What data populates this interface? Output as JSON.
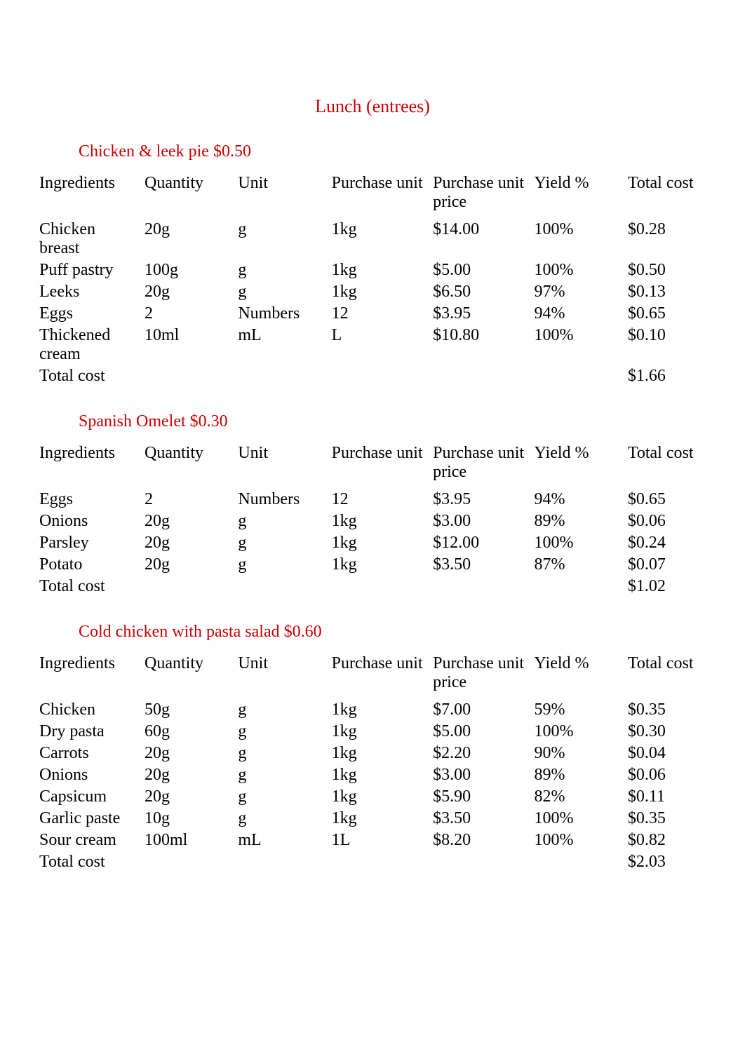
{
  "page_title": "Lunch (entrees)",
  "columns": {
    "ingredients": "Ingredients",
    "quantity": "Quantity",
    "unit": "Unit",
    "purchase_unit": "Purchase unit",
    "purchase_unit_price": "Purchase unit price",
    "yield": "Yield %",
    "total_cost": "Total cost"
  },
  "total_cost_label": "Total cost",
  "recipes": [
    {
      "title": "Chicken & leek pie $0.50",
      "total": "$1.66",
      "rows": [
        {
          "ingredient": "Chicken breast",
          "quantity": "20g",
          "unit": "g",
          "purchase_unit": "1kg",
          "purchase_unit_price": "$14.00",
          "yield": "100%",
          "total_cost": "$0.28"
        },
        {
          "ingredient": "Puff pastry",
          "quantity": "100g",
          "unit": "g",
          "purchase_unit": "1kg",
          "purchase_unit_price": "$5.00",
          "yield": "100%",
          "total_cost": "$0.50"
        },
        {
          "ingredient": "Leeks",
          "quantity": "20g",
          "unit": "g",
          "purchase_unit": "1kg",
          "purchase_unit_price": "$6.50",
          "yield": "97%",
          "total_cost": "$0.13"
        },
        {
          "ingredient": "Eggs",
          "quantity": "2",
          "unit": "Numbers",
          "purchase_unit": "12",
          "purchase_unit_price": "$3.95",
          "yield": "94%",
          "total_cost": "$0.65"
        },
        {
          "ingredient": "Thickened cream",
          "quantity": "10ml",
          "unit": "mL",
          "purchase_unit": "L",
          "purchase_unit_price": "$10.80",
          "yield": "100%",
          "total_cost": "$0.10"
        }
      ]
    },
    {
      "title": "Spanish Omelet $0.30",
      "total": "$1.02",
      "rows": [
        {
          "ingredient": "Eggs",
          "quantity": "2",
          "unit": "Numbers",
          "purchase_unit": "12",
          "purchase_unit_price": "$3.95",
          "yield": "94%",
          "total_cost": "$0.65"
        },
        {
          "ingredient": "Onions",
          "quantity": "20g",
          "unit": "g",
          "purchase_unit": "1kg",
          "purchase_unit_price": "$3.00",
          "yield": "89%",
          "total_cost": "$0.06"
        },
        {
          "ingredient": "Parsley",
          "quantity": "20g",
          "unit": "g",
          "purchase_unit": "1kg",
          "purchase_unit_price": "$12.00",
          "yield": "100%",
          "total_cost": "$0.24"
        },
        {
          "ingredient": "Potato",
          "quantity": "20g",
          "unit": "g",
          "purchase_unit": "1kg",
          "purchase_unit_price": "$3.50",
          "yield": "87%",
          "total_cost": "$0.07"
        }
      ]
    },
    {
      "title": "Cold chicken with pasta salad $0.60",
      "total": "$2.03",
      "rows": [
        {
          "ingredient": "Chicken",
          "quantity": "50g",
          "unit": "g",
          "purchase_unit": "1kg",
          "purchase_unit_price": "$7.00",
          "yield": "59%",
          "total_cost": "$0.35"
        },
        {
          "ingredient": "Dry pasta",
          "quantity": "60g",
          "unit": "g",
          "purchase_unit": "1kg",
          "purchase_unit_price": "$5.00",
          "yield": "100%",
          "total_cost": "$0.30"
        },
        {
          "ingredient": "Carrots",
          "quantity": "20g",
          "unit": "g",
          "purchase_unit": "1kg",
          "purchase_unit_price": "$2.20",
          "yield": "90%",
          "total_cost": "$0.04"
        },
        {
          "ingredient": "Onions",
          "quantity": "20g",
          "unit": "g",
          "purchase_unit": "1kg",
          "purchase_unit_price": "$3.00",
          "yield": "89%",
          "total_cost": "$0.06"
        },
        {
          "ingredient": "Capsicum",
          "quantity": "20g",
          "unit": "g",
          "purchase_unit": "1kg",
          "purchase_unit_price": "$5.90",
          "yield": "82%",
          "total_cost": "$0.11"
        },
        {
          "ingredient": "Garlic paste",
          "quantity": "10g",
          "unit": "g",
          "purchase_unit": "1kg",
          "purchase_unit_price": "$3.50",
          "yield": "100%",
          "total_cost": "$0.35"
        },
        {
          "ingredient": "Sour cream",
          "quantity": "100ml",
          "unit": "mL",
          "purchase_unit": "1L",
          "purchase_unit_price": "$8.20",
          "yield": "100%",
          "total_cost": "$0.82"
        }
      ]
    }
  ]
}
